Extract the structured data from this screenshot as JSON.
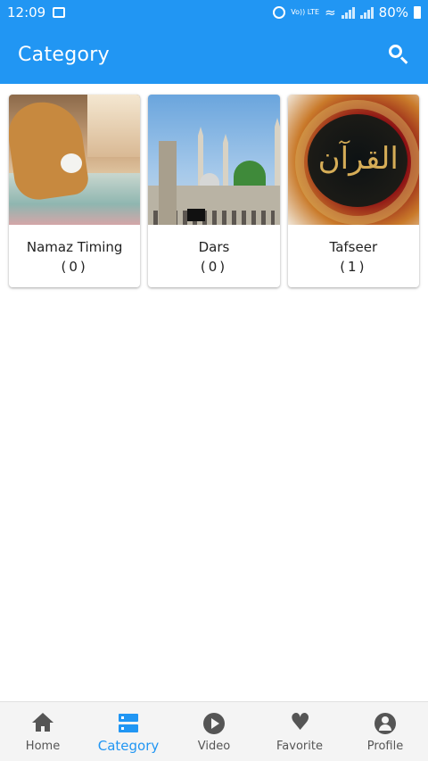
{
  "status_bar": {
    "time": "12:09",
    "volte_label": "Vo)) LTE",
    "battery": "80%"
  },
  "app_bar": {
    "title": "Category",
    "search_icon": "search-icon"
  },
  "categories": [
    {
      "name": "Namaz Timing",
      "count": "(0)",
      "image": "prayer-photo"
    },
    {
      "name": "Dars",
      "count": "(0)",
      "image": "mosque-photo"
    },
    {
      "name": "Tafseer",
      "count": "(1)",
      "image": "quran-photo"
    }
  ],
  "bottom_nav": {
    "active": "Category",
    "items": [
      {
        "label": "Home",
        "icon": "home-icon"
      },
      {
        "label": "Category",
        "icon": "category-icon"
      },
      {
        "label": "Video",
        "icon": "play-circle-icon"
      },
      {
        "label": "Favorite",
        "icon": "heart-icon"
      },
      {
        "label": "Profile",
        "icon": "profile-icon"
      }
    ]
  },
  "colors": {
    "primary": "#2196F3",
    "nav_background": "#f4f4f4",
    "inactive_icon": "#555555"
  }
}
